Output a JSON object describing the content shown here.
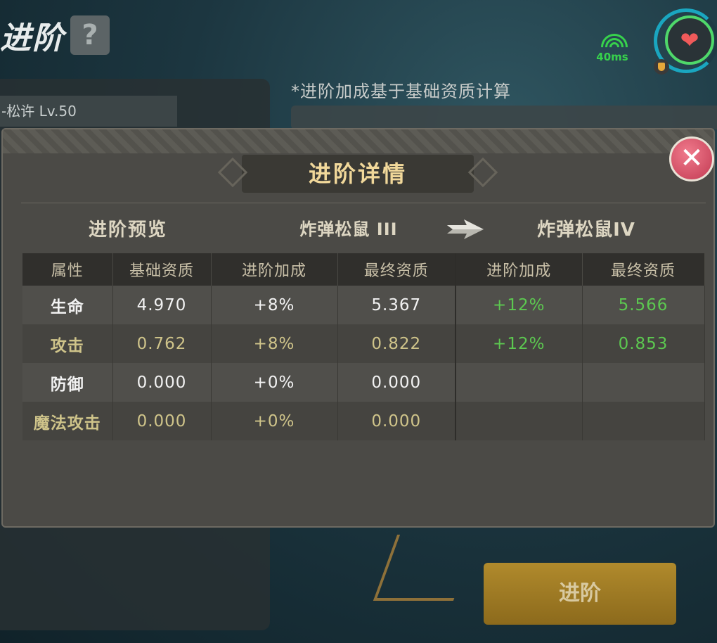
{
  "header": {
    "title": "进阶",
    "help_label": "?",
    "ping": "40ms"
  },
  "left_panel": {
    "char_name": "-松许 Lv.50"
  },
  "note": "*进阶加成基于基础资质计算",
  "advance_button": "进阶",
  "modal": {
    "title": "进阶详情",
    "preview_label": "进阶预览",
    "from_name": "炸弹松鼠 III",
    "to_name": "炸弹松鼠IV",
    "close_label": "✕",
    "columns": [
      "属性",
      "基础资质",
      "进阶加成",
      "最终资质",
      "进阶加成",
      "最终资质"
    ],
    "rows": [
      {
        "attr": "生命",
        "base": "4.970",
        "bonus": "+8%",
        "final": "5.367",
        "next_bonus": "+12%",
        "next_final": "5.566"
      },
      {
        "attr": "攻击",
        "base": "0.762",
        "bonus": "+8%",
        "final": "0.822",
        "next_bonus": "+12%",
        "next_final": "0.853"
      },
      {
        "attr": "防御",
        "base": "0.000",
        "bonus": "+0%",
        "final": "0.000",
        "next_bonus": "",
        "next_final": ""
      },
      {
        "attr": "魔法攻击",
        "base": "0.000",
        "bonus": "+0%",
        "final": "0.000",
        "next_bonus": "",
        "next_final": ""
      }
    ]
  },
  "colors": {
    "accent_gold": "#f1d89a",
    "value_green": "#5cc850",
    "ping_green": "#37d24c"
  }
}
